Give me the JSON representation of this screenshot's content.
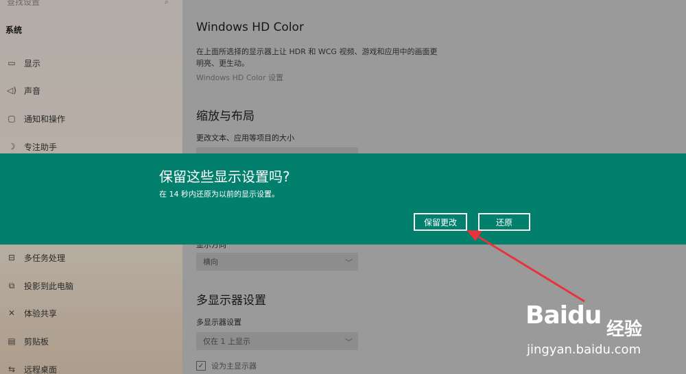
{
  "sidebar": {
    "search_placeholder": "查找设置",
    "search_icon": "search-icon",
    "section_title": "系统",
    "items": [
      {
        "label": "显示",
        "icon": "display-icon"
      },
      {
        "label": "声音",
        "icon": "speaker-icon"
      },
      {
        "label": "通知和操作",
        "icon": "notification-icon"
      },
      {
        "label": "专注助手",
        "icon": "moon-icon"
      },
      {
        "label": "多任务处理",
        "icon": "multitask-icon"
      },
      {
        "label": "投影到此电脑",
        "icon": "project-icon"
      },
      {
        "label": "体验共享",
        "icon": "share-icon"
      },
      {
        "label": "剪贴板",
        "icon": "clipboard-icon"
      },
      {
        "label": "远程桌面",
        "icon": "remote-desktop-icon"
      }
    ]
  },
  "main": {
    "hd_color": {
      "title": "Windows HD Color",
      "desc_line1": "在上面所选择的显示器上让 HDR 和 WCG 视频、游戏和应用中的画面更",
      "desc_line2": "明亮、更生动。",
      "link": "Windows HD Color 设置"
    },
    "scale_layout": {
      "title": "缩放与布局",
      "text_size_label": "更改文本、应用等项目的大小",
      "orientation_label_partial": "显示方向",
      "orientation_value": "横向"
    },
    "multi_display": {
      "title": "多显示器设置",
      "label": "多显示器设置",
      "value": "仅在 1 上显示",
      "checkbox_label": "设为主显示器"
    }
  },
  "dialog": {
    "title": "保留这些显示设置吗?",
    "subtitle": "在 14 秒内还原为以前的显示设置。",
    "keep_button": "保留更改",
    "revert_button": "还原"
  },
  "watermark": {
    "logo": "Baidu",
    "logo_cn": "经验",
    "url": "jingyan.baidu.com"
  },
  "annotation_color": "#e8323c"
}
